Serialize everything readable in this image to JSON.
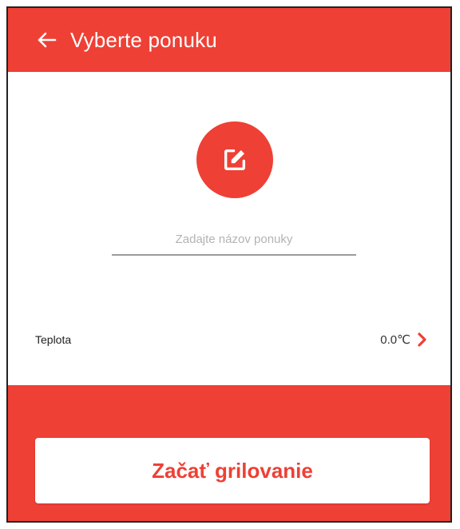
{
  "app_bar": {
    "title": "Vyberte ponuku",
    "back_icon": "arrow-left-icon"
  },
  "edit_button": {
    "icon": "edit-icon"
  },
  "name_input": {
    "placeholder": "Zadajte názov ponuky",
    "value": ""
  },
  "temperature": {
    "label": "Teplota",
    "value": "0.0℃",
    "chevron_icon": "chevron-right-icon"
  },
  "start_button": {
    "label": "Začať grilovanie"
  },
  "colors": {
    "accent": "#ee4035",
    "background": "#ffffff",
    "text": "#222222",
    "placeholder": "#b3b3b3"
  }
}
